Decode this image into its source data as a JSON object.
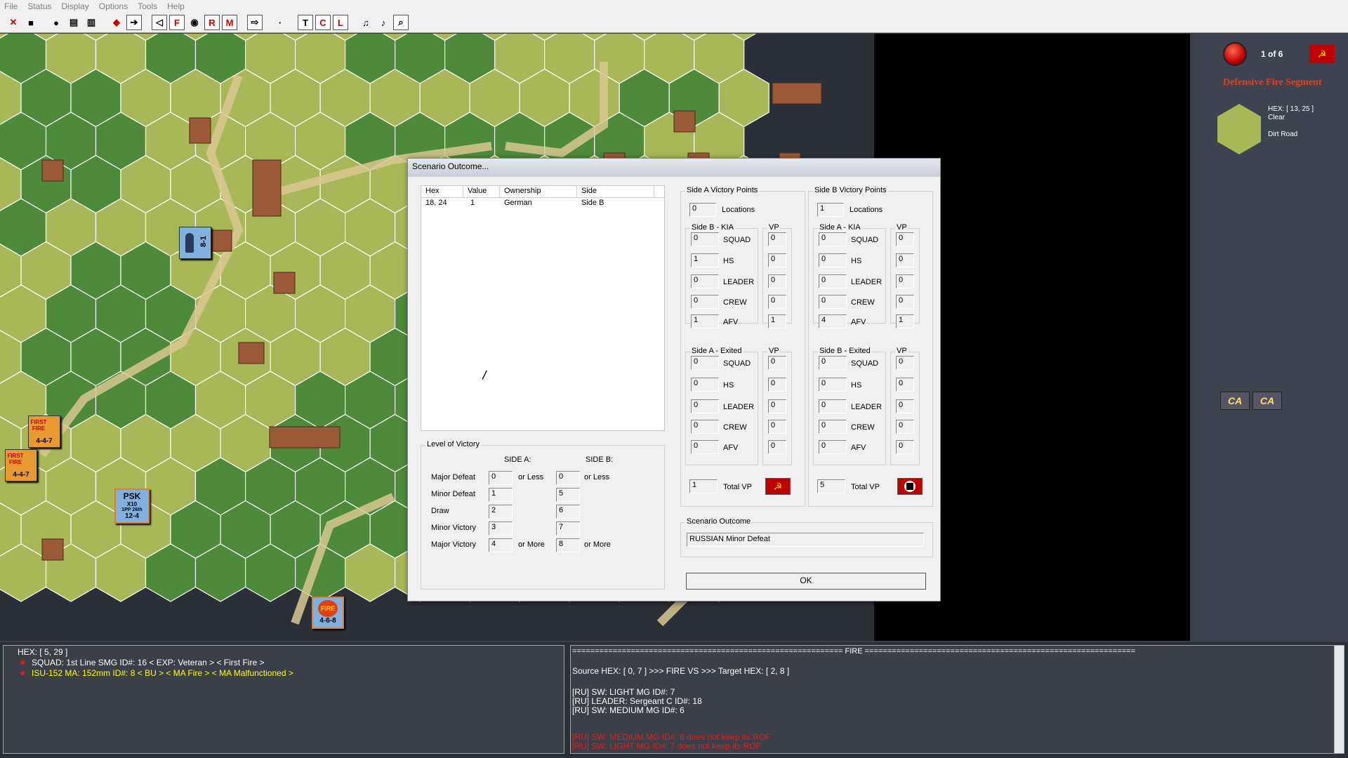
{
  "menu": [
    "File",
    "Status",
    "Display",
    "Options",
    "Tools",
    "Help"
  ],
  "toolbar_icons": [
    "close-icon",
    "save-icon",
    "globe-icon",
    "calc-icon",
    "disk-icon",
    "tank-icon",
    "arrow-icon",
    "back-icon",
    "F",
    "eye-icon",
    "R",
    "M",
    "right-arrow-icon",
    "dot",
    "T",
    "C",
    "L",
    "notes-icon",
    "music-icon",
    "magnify-icon"
  ],
  "side_panel": {
    "turn": "1 of 6",
    "phase": "Defensive Fire Segment",
    "hex": "HEX: [ 13, 25 ]",
    "terrain": "Clear",
    "road": "Dirt Road",
    "ca1": "CA",
    "ca2": "CA"
  },
  "counters": {
    "hq": "8-1",
    "psk": "PSK",
    "psk_sub": "X10",
    "psk_id": "1PP 26th",
    "psk_val": "12-4",
    "ff1": "FIRST FIRE",
    "ff1_val": "4-4-7",
    "ff2": "FIRST FIRE",
    "ff2_val": "4-4-7",
    "fire": "FIRE",
    "fire_val": "4-6-8"
  },
  "dialog": {
    "title": "Scenario Outcome...",
    "table_headers": [
      "Hex",
      "Value",
      "Ownership",
      "Side"
    ],
    "table_rows": [
      [
        "18, 24",
        "1",
        "German",
        "Side B"
      ]
    ],
    "level_title": "Level of Victory",
    "side_a": "SIDE A:",
    "side_b": "SIDE B:",
    "levels": [
      {
        "label": "Major Defeat",
        "a": "0",
        "a_suffix": "or Less",
        "b": "0",
        "b_suffix": "or Less"
      },
      {
        "label": "Minor Defeat",
        "a": "1",
        "a_suffix": "",
        "b": "5",
        "b_suffix": ""
      },
      {
        "label": "Draw",
        "a": "2",
        "a_suffix": "",
        "b": "6",
        "b_suffix": ""
      },
      {
        "label": "Minor Victory",
        "a": "3",
        "a_suffix": "",
        "b": "7",
        "b_suffix": ""
      },
      {
        "label": "Major Victory",
        "a": "4",
        "a_suffix": "or More",
        "b": "8",
        "b_suffix": "or More"
      }
    ],
    "side_a_vp": {
      "title": "Side A Victory Points",
      "locations": "0",
      "locations_label": "Locations",
      "kia_title": "Side B - KIA",
      "vp_title": "VP",
      "kia": [
        {
          "l": "SQUAD",
          "n": "0",
          "v": "0"
        },
        {
          "l": "HS",
          "n": "1",
          "v": "0"
        },
        {
          "l": "LEADER",
          "n": "0",
          "v": "0"
        },
        {
          "l": "CREW",
          "n": "0",
          "v": "0"
        },
        {
          "l": "AFV",
          "n": "1",
          "v": "1"
        }
      ],
      "exit_title": "Side A - Exited",
      "exit": [
        {
          "l": "SQUAD",
          "n": "0",
          "v": "0"
        },
        {
          "l": "HS",
          "n": "0",
          "v": "0"
        },
        {
          "l": "LEADER",
          "n": "0",
          "v": "0"
        },
        {
          "l": "CREW",
          "n": "0",
          "v": "0"
        },
        {
          "l": "AFV",
          "n": "0",
          "v": "0"
        }
      ],
      "total": "1",
      "total_label": "Total VP"
    },
    "side_b_vp": {
      "title": "Side B Victory Points",
      "locations": "1",
      "locations_label": "Locations",
      "kia_title": "Side A - KIA",
      "vp_title": "VP",
      "kia": [
        {
          "l": "SQUAD",
          "n": "0",
          "v": "0"
        },
        {
          "l": "HS",
          "n": "0",
          "v": "0"
        },
        {
          "l": "LEADER",
          "n": "0",
          "v": "0"
        },
        {
          "l": "CREW",
          "n": "0",
          "v": "0"
        },
        {
          "l": "AFV",
          "n": "4",
          "v": "1"
        }
      ],
      "exit_title": "Side B - Exited",
      "exit": [
        {
          "l": "SQUAD",
          "n": "0",
          "v": "0"
        },
        {
          "l": "HS",
          "n": "0",
          "v": "0"
        },
        {
          "l": "LEADER",
          "n": "0",
          "v": "0"
        },
        {
          "l": "CREW",
          "n": "0",
          "v": "0"
        },
        {
          "l": "AFV",
          "n": "0",
          "v": "0"
        }
      ],
      "total": "5",
      "total_label": "Total VP"
    },
    "outcome_title": "Scenario Outcome",
    "outcome": "RUSSIAN Minor Defeat",
    "ok": "OK"
  },
  "status_left": {
    "hex": "HEX: [ 5, 29 ]",
    "line1": "SQUAD: 1st Line SMG   ID#: 16 < EXP: Veteran >  < First Fire >",
    "line2": "ISU-152  MA: 152mm    ID#: 8   < BU >  < MA Fire >  < MA Malfunctioned >"
  },
  "status_right": {
    "header": "============================================================ FIRE ============================================================",
    "line1": "Source HEX: [ 0, 7 ]  >>> FIRE VS >>>   Target HEX: [ 2, 8 ]",
    "line2": "[RU] SW: LIGHT MG ID#: 7",
    "line3": "[RU] LEADER: Sergeant C ID#: 18",
    "line4": "[RU] SW: MEDIUM MG ID#: 6",
    "line5": "[RU] SW: MEDIUM MG ID#: 6 does not keep its ROF",
    "line6": "[RU] SW: LIGHT MG ID#: 7 does not keep its ROF"
  },
  "colors": {
    "hex_green": "#a8b858",
    "woods": "#4d8a3a",
    "road": "#d8c890",
    "accent_red": "#cc2020"
  }
}
